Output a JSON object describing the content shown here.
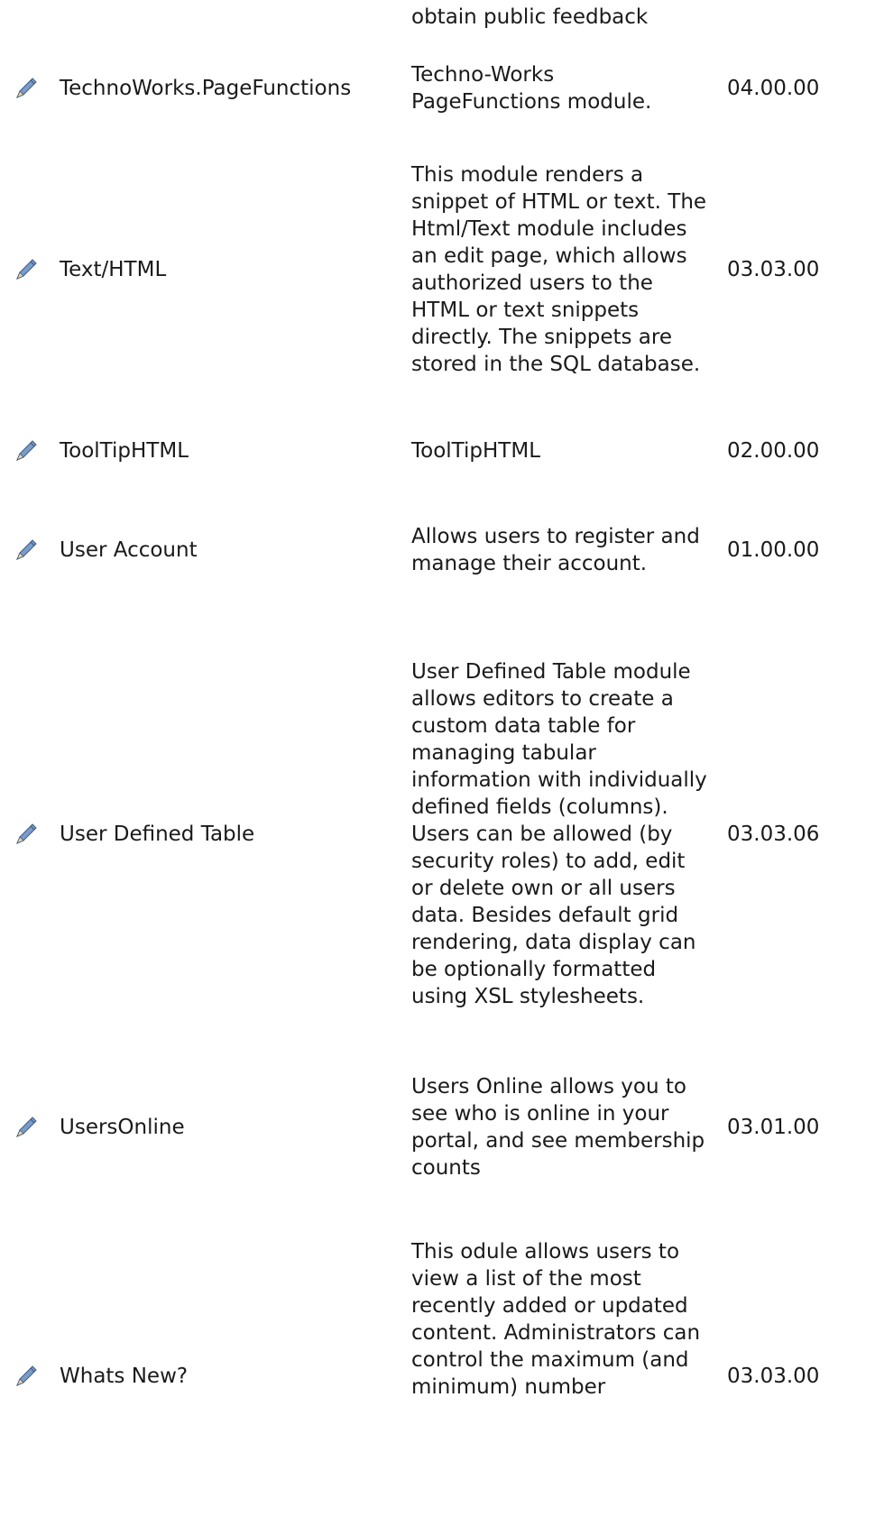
{
  "top_fragment": {
    "description": "obtain public feedback"
  },
  "icons": {
    "edit": "pencil-icon"
  },
  "colors": {
    "pencil_body": "#7a9cc6",
    "pencil_tip": "#f2d29b",
    "pencil_dark": "#3b5b8a"
  },
  "modules": [
    {
      "name": "TechnoWorks.PageFunctions",
      "description": "Techno-Works PageFunctions module.",
      "version": "04.00.00"
    },
    {
      "name": "Text/HTML",
      "description": "This module renders a snippet of HTML or text. The Html/Text module includes an edit page, which allows authorized users to the HTML or text snippets directly. The snippets are stored in the SQL database.",
      "version": "03.03.00"
    },
    {
      "name": "ToolTipHTML",
      "description": "ToolTipHTML",
      "version": "02.00.00"
    },
    {
      "name": "User Account",
      "description": "Allows users to register and manage their account.",
      "version": "01.00.00"
    },
    {
      "name": "User Defined Table",
      "description": "User Defined Table module allows editors to create a custom data table for managing tabular information with individually defined fields (columns). Users can be allowed (by security roles) to add, edit or delete own or all users data. Besides default grid rendering, data display can be optionally formatted using XSL stylesheets.",
      "version": "03.03.06"
    },
    {
      "name": "UsersOnline",
      "description": "Users Online allows you to see who is online in your portal, and see membership counts",
      "version": "03.01.00"
    },
    {
      "name": "Whats New?",
      "description": "This odule allows users to view a list of the most recently added or updated content. Administrators can control the maximum (and minimum) number",
      "version": "03.03.00"
    }
  ]
}
